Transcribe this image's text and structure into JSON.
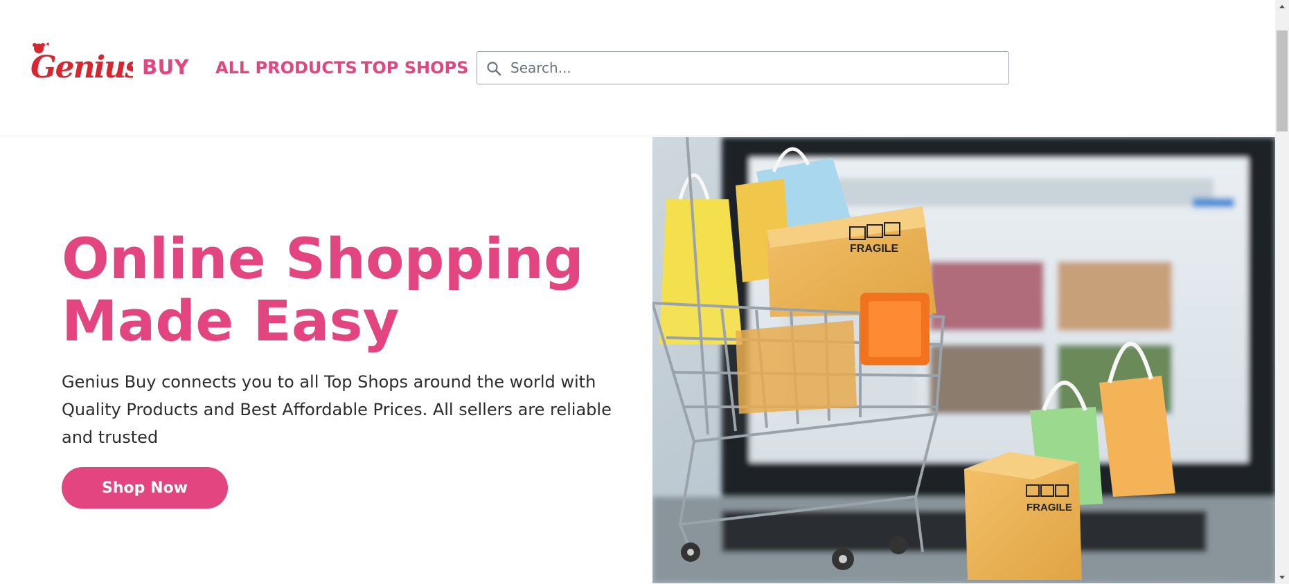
{
  "brand": {
    "logo_text": "Genius",
    "buy_label": "BUY"
  },
  "nav": {
    "all_products": "ALL PRODUCTS",
    "top_shops": "TOP SHOPS"
  },
  "search": {
    "placeholder": "Search...",
    "value": ""
  },
  "hero": {
    "title_line1": "Online Shopping",
    "title_line2": "Made Easy",
    "description": "Genius Buy connects you to all Top Shops around the world with Quality Products and Best Affordable Prices. All sellers are reliable and trusted",
    "button_label": "Shop Now",
    "image_label_1": "FRAGILE",
    "image_label_2": "FRAGILE"
  },
  "colors": {
    "accent": "#e2457f",
    "logo_red": "#d7262f"
  }
}
